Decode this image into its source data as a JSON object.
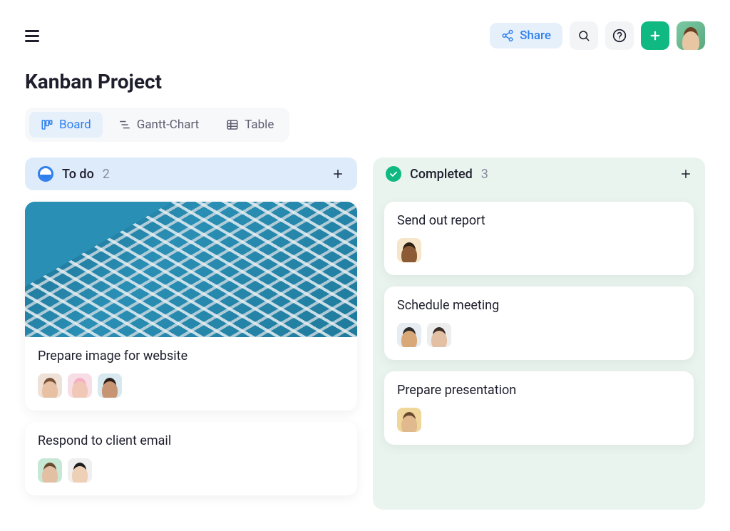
{
  "header": {
    "share_label": "Share"
  },
  "page": {
    "title": "Kanban Project"
  },
  "views": {
    "board": "Board",
    "gantt": "Gantt-Chart",
    "table": "Table"
  },
  "columns": [
    {
      "key": "todo",
      "name": "To do",
      "count": "2",
      "cards": [
        {
          "title": "Prepare image for website",
          "has_image": true,
          "assignees": [
            "av1",
            "av2",
            "av3"
          ]
        },
        {
          "title": "Respond to client email",
          "assignees": [
            "av4",
            "av5"
          ]
        }
      ]
    },
    {
      "key": "completed",
      "name": "Completed",
      "count": "3",
      "cards": [
        {
          "title": "Send out report",
          "assignees": [
            "av6"
          ]
        },
        {
          "title": "Schedule meeting",
          "assignees": [
            "av7",
            "av8"
          ]
        },
        {
          "title": "Prepare presentation",
          "assignees": [
            "av9"
          ]
        }
      ]
    }
  ]
}
